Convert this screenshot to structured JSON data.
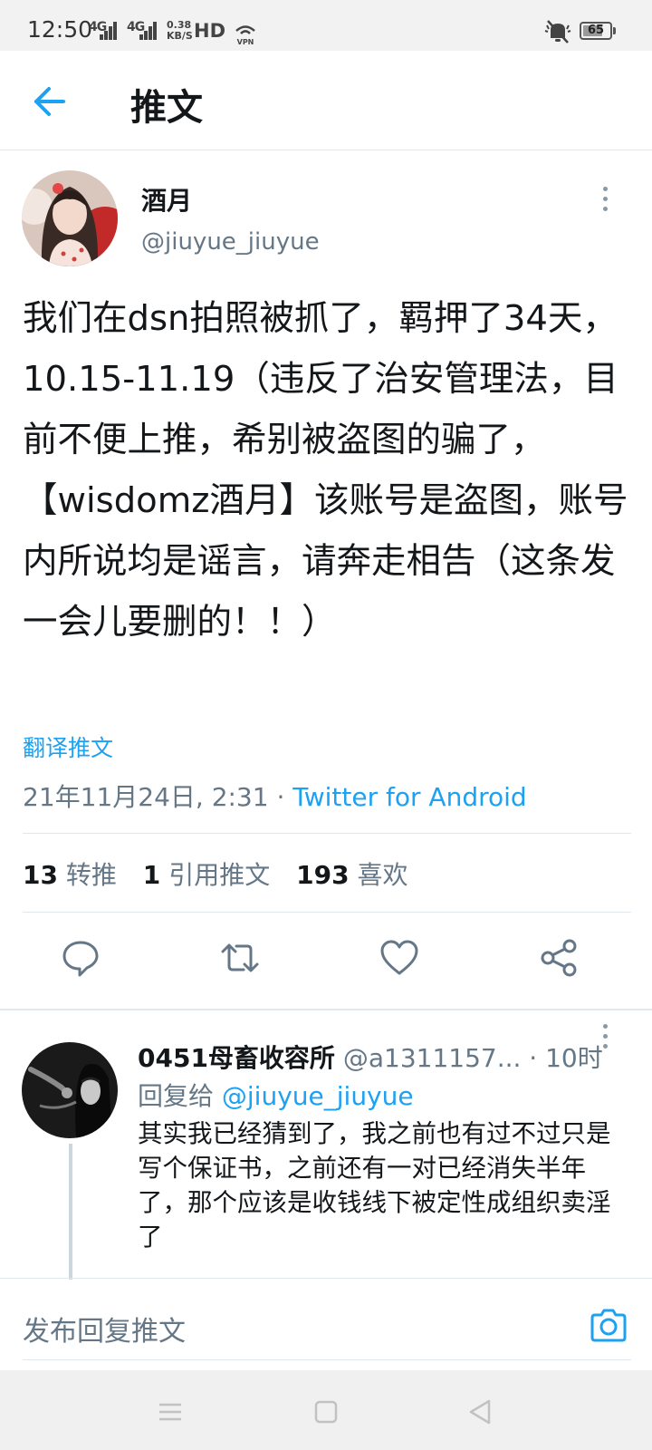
{
  "status_bar": {
    "time": "12:50",
    "signal_1": "4G",
    "signal_2": "4G",
    "speed_value": "0.38",
    "speed_unit": "KB/S",
    "hd": "HD",
    "vpn": "VPN",
    "battery": "65"
  },
  "header": {
    "back_icon": "arrow-left-icon",
    "title": "推文"
  },
  "tweet": {
    "author_name": "酒月",
    "author_handle": "@jiuyue_jiuyue",
    "text": "我们在dsn拍照被抓了，羁押了34天，10.15-11.19（违反了治安管理法，目前不便上推，希别被盗图的骗了，【wisdomz酒月】该账号是盗图，账号内所说均是谣言，请奔走相告（这条发一会儿要删的！！）",
    "translate": "翻译推文",
    "datetime": "21年11月24日, 2:31",
    "separator": " · ",
    "source": "Twitter for Android",
    "stats": {
      "retweets_count": "13",
      "retweets_label": "转推",
      "quotes_count": "1",
      "quotes_label": "引用推文",
      "likes_count": "193",
      "likes_label": "喜欢"
    },
    "actions": [
      "reply-icon",
      "retweet-icon",
      "like-icon",
      "share-icon"
    ]
  },
  "reply": {
    "name": "0451母畜收容所",
    "handle": "@a1311157...",
    "time": " · 10时",
    "replying_prefix": "回复给 ",
    "replying_to": "@jiuyue_jiuyue",
    "text": "其实我已经猜到了，我之前也有过不过只是写个保证书，之前还有一对已经消失半年了，那个应该是收钱线下被定性成组织卖淫了"
  },
  "compose": {
    "placeholder": "发布回复推文",
    "camera_icon": "camera-icon"
  },
  "colors": {
    "accent": "#1da1f2",
    "secondary_text": "#657786",
    "primary_text": "#14171a",
    "divider": "#e1e8ed"
  }
}
